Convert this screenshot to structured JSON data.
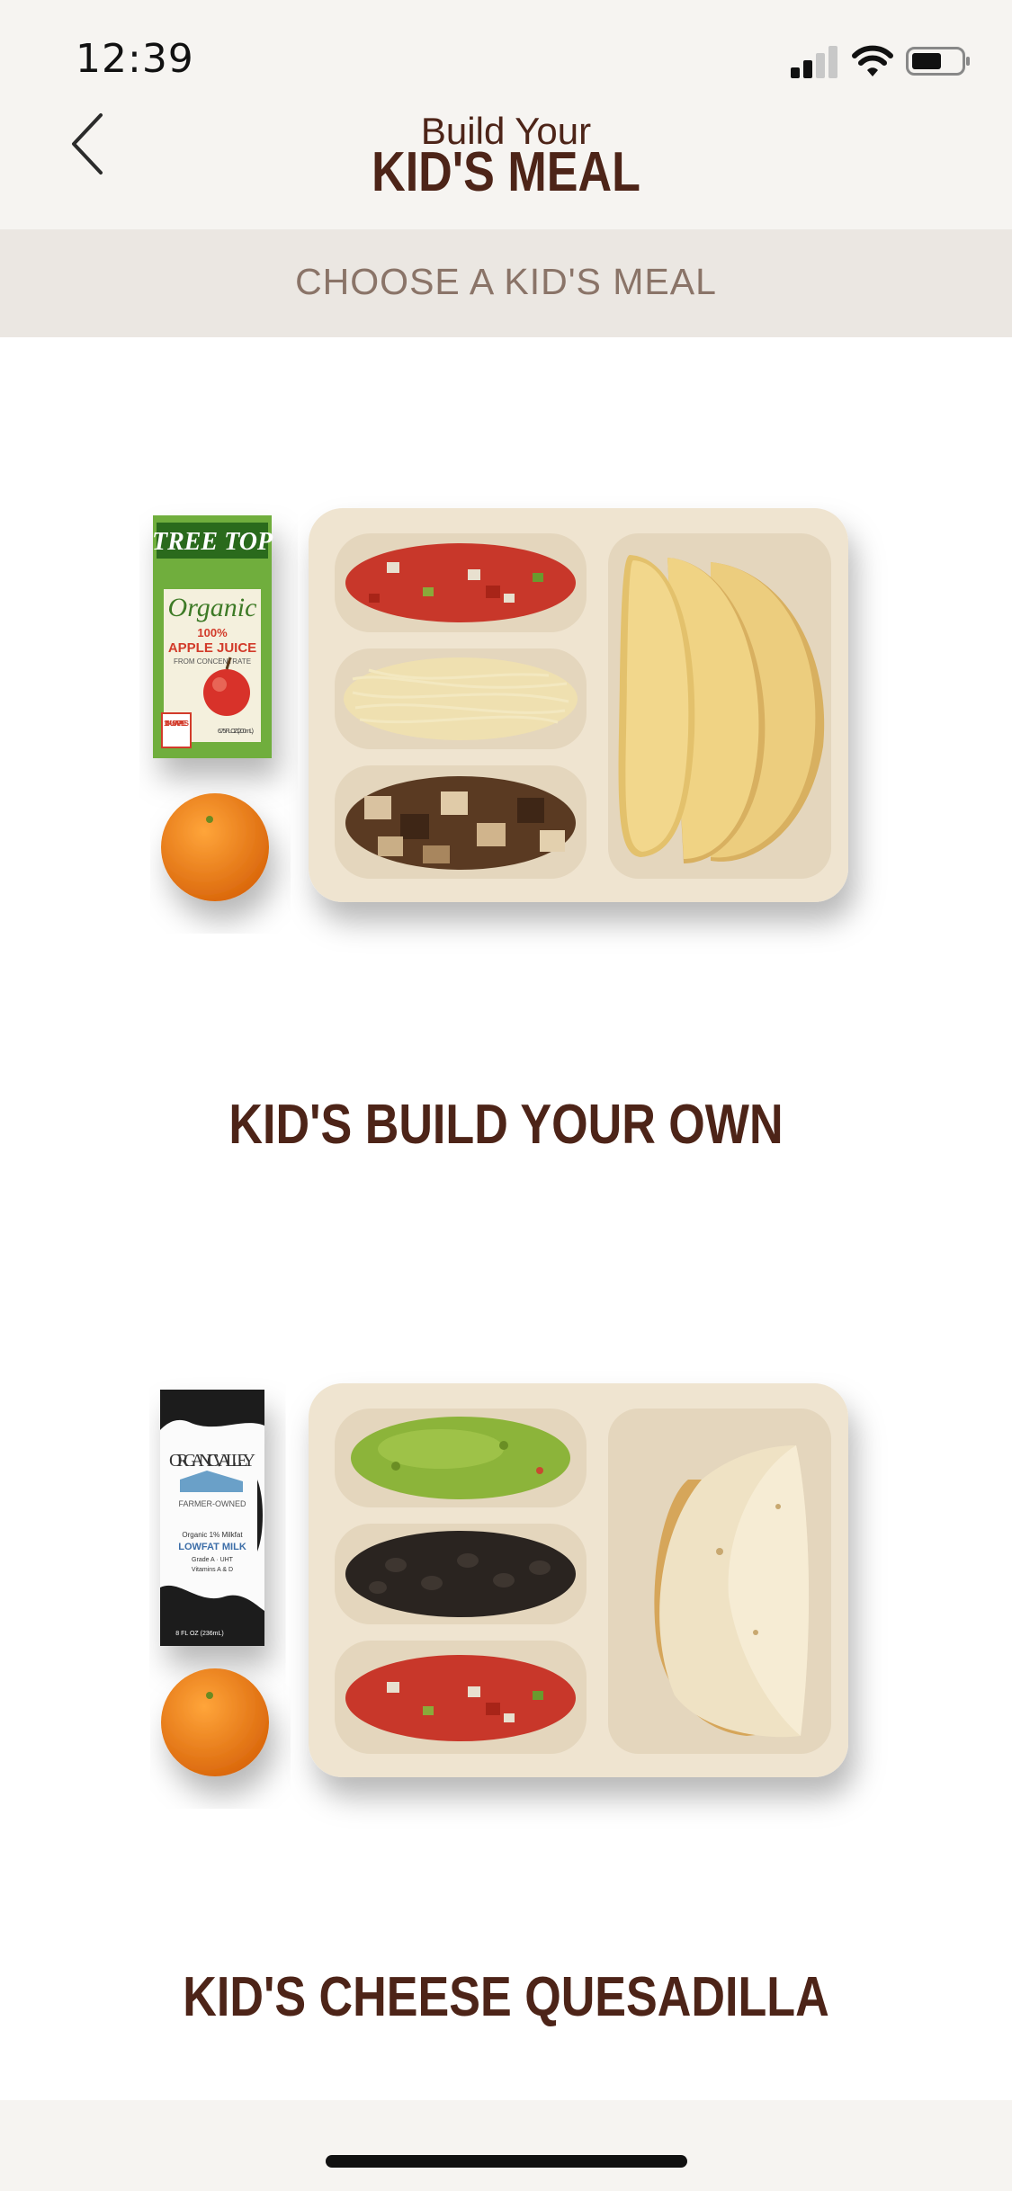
{
  "status_bar": {
    "time": "12:39",
    "icons": [
      "cellular-signal-icon",
      "wifi-icon",
      "battery-icon"
    ]
  },
  "header": {
    "back_icon": "chevron-left-icon",
    "subtitle": "Build Your",
    "title": "KID'S MEAL"
  },
  "section": {
    "label": "CHOOSE A KID'S MEAL"
  },
  "meals": [
    {
      "name": "KID'S BUILD YOUR OWN",
      "drink_brand": "TREE TOP",
      "drink_lines": [
        "Organic",
        "100%",
        "APPLE JUICE",
        "FROM CONCENTRATE"
      ],
      "drink_badge": "100% USA APPLES",
      "drink_size": "6.75 FL OZ (200 mL)"
    },
    {
      "name": "KID'S CHEESE QUESADILLA",
      "drink_brand": "ORGANIC VALLEY",
      "drink_lines": [
        "FARMER-OWNED",
        "Organic 1% Milkfat",
        "LOWFAT MILK",
        "Grade A · UHT",
        "Vitamins A & D"
      ],
      "drink_size": "8 FL OZ (236mL)"
    }
  ],
  "colors": {
    "brand_brown": "#4d2418",
    "header_bg": "#f6f4f1",
    "section_bg": "#ebe7e2",
    "section_text": "#8a7468",
    "tray": "#efe4d0"
  }
}
